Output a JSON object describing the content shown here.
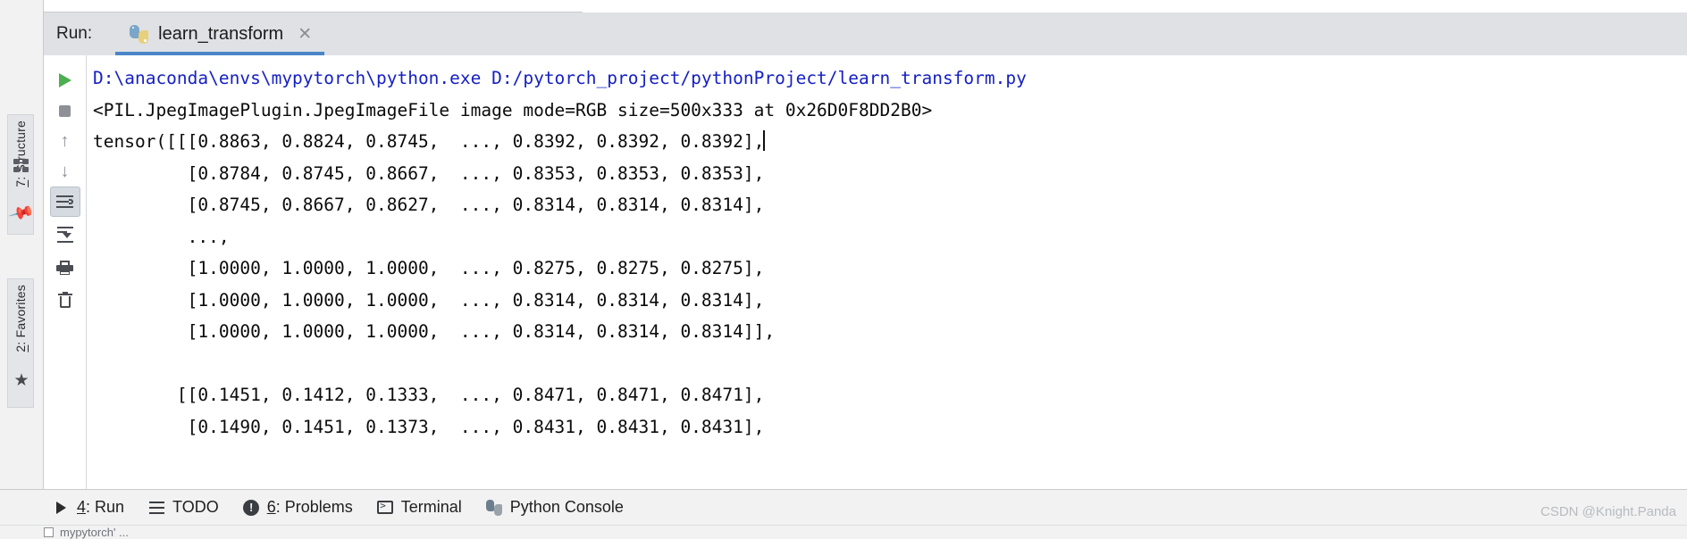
{
  "window": {
    "run_label": "Run:",
    "tab": {
      "title": "learn_transform",
      "icon": "python-file-icon",
      "close_icon": "close-icon"
    }
  },
  "colors": {
    "tab_underline": "#4a86c8",
    "header_bg": "#dfe1e5",
    "console_bg": "#ffffff",
    "command_text": "#1520c4",
    "output_text": "#0b0b0b",
    "run_green": "#4caf50",
    "watermark": "#b8bbbf"
  },
  "left_tool_bar": {
    "items": [
      {
        "label": "7: Structure",
        "mnemonic": "7",
        "name": "sidebar-item-structure"
      },
      {
        "label": "2: Favorites",
        "mnemonic": "2",
        "name": "sidebar-item-favorites"
      }
    ],
    "icons": [
      "grid-dots-icon",
      "structure-squares-icon",
      "pin-icon",
      "star-icon"
    ]
  },
  "console_toolbar": {
    "buttons": [
      {
        "name": "rerun-button",
        "icon": "play-icon",
        "tooltip": "Rerun"
      },
      {
        "name": "stop-button",
        "icon": "stop-icon",
        "tooltip": "Stop"
      },
      {
        "name": "up-button",
        "icon": "arrow-up-icon",
        "tooltip": "Up"
      },
      {
        "name": "down-button",
        "icon": "arrow-down-icon",
        "tooltip": "Down"
      },
      {
        "name": "soft-wrap-button",
        "icon": "soft-wrap-icon",
        "tooltip": "Soft-Wrap",
        "active": true
      },
      {
        "name": "scroll-to-end-button",
        "icon": "scroll-to-end-icon",
        "tooltip": "Scroll to End"
      },
      {
        "name": "print-button",
        "icon": "print-icon",
        "tooltip": "Print"
      },
      {
        "name": "clear-all-button",
        "icon": "trash-icon",
        "tooltip": "Clear All"
      }
    ]
  },
  "console": {
    "lines": [
      {
        "type": "cmd",
        "text": "D:\\anaconda\\envs\\mypytorch\\python.exe D:/pytorch_project/pythonProject/learn_transform.py"
      },
      {
        "type": "out",
        "text": "<PIL.JpegImagePlugin.JpegImageFile image mode=RGB size=500x333 at 0x26D0F8DD2B0>"
      },
      {
        "type": "out",
        "text": "tensor([[[0.8863, 0.8824, 0.8745,  ..., 0.8392, 0.8392, 0.8392],",
        "caret": true
      },
      {
        "type": "out",
        "text": "         [0.8784, 0.8745, 0.8667,  ..., 0.8353, 0.8353, 0.8353],"
      },
      {
        "type": "out",
        "text": "         [0.8745, 0.8667, 0.8627,  ..., 0.8314, 0.8314, 0.8314],"
      },
      {
        "type": "out",
        "text": "         ...,"
      },
      {
        "type": "out",
        "text": "         [1.0000, 1.0000, 1.0000,  ..., 0.8275, 0.8275, 0.8275],"
      },
      {
        "type": "out",
        "text": "         [1.0000, 1.0000, 1.0000,  ..., 0.8314, 0.8314, 0.8314],"
      },
      {
        "type": "out",
        "text": "         [1.0000, 1.0000, 1.0000,  ..., 0.8314, 0.8314, 0.8314]],"
      },
      {
        "type": "out",
        "text": ""
      },
      {
        "type": "out",
        "text": "        [[0.1451, 0.1412, 0.1333,  ..., 0.8471, 0.8471, 0.8471],"
      },
      {
        "type": "out",
        "text": "         [0.1490, 0.1451, 0.1373,  ..., 0.8431, 0.8431, 0.8431],"
      }
    ]
  },
  "bottom_bar": {
    "items": [
      {
        "label": "4: Run",
        "mnemonic": "4",
        "icon": "run-icon",
        "name": "bottom-tab-run",
        "selected": true
      },
      {
        "label": "TODO",
        "mnemonic": "",
        "icon": "todo-list-icon",
        "name": "bottom-tab-todo",
        "selected": false
      },
      {
        "label": "6: Problems",
        "mnemonic": "6",
        "icon": "problems-icon",
        "name": "bottom-tab-problems",
        "selected": false
      },
      {
        "label": "Terminal",
        "mnemonic": "",
        "icon": "terminal-icon",
        "name": "bottom-tab-terminal",
        "selected": false
      },
      {
        "label": "Python Console",
        "mnemonic": "",
        "icon": "python-console-icon",
        "name": "bottom-tab-python-console",
        "selected": false
      }
    ],
    "watermark": "CSDN @Knight.Panda"
  },
  "status_sliver": {
    "text": "mypytorch'  ..."
  }
}
